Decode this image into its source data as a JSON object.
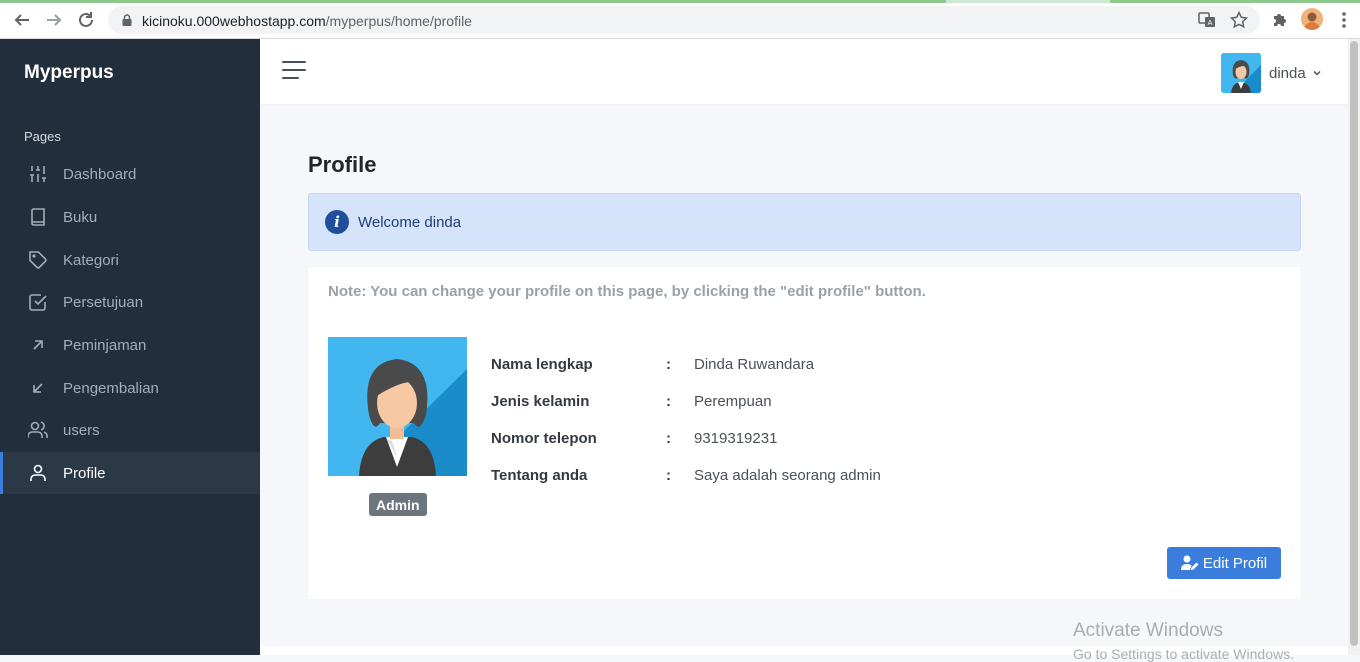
{
  "browser": {
    "url_host": "kicinoku.000webhostapp.com",
    "url_path": "/myperpus/home/profile"
  },
  "sidebar": {
    "brand": "Myperpus",
    "section_label": "Pages",
    "items": [
      {
        "label": "Dashboard",
        "icon": "sliders-icon"
      },
      {
        "label": "Buku",
        "icon": "book-icon"
      },
      {
        "label": "Kategori",
        "icon": "tag-icon"
      },
      {
        "label": "Persetujuan",
        "icon": "check-square-icon"
      },
      {
        "label": "Peminjaman",
        "icon": "arrow-up-right-icon"
      },
      {
        "label": "Pengembalian",
        "icon": "arrow-down-left-icon"
      },
      {
        "label": "users",
        "icon": "users-icon"
      },
      {
        "label": "Profile",
        "icon": "user-icon",
        "active": true
      }
    ]
  },
  "topbar": {
    "username": "dinda"
  },
  "main": {
    "title": "Profile",
    "alert": "Welcome dinda",
    "note": "Note: You can change your profile on this page, by clicking the \"edit profile\" button.",
    "role": "Admin",
    "fields": [
      {
        "label": "Nama lengkap",
        "value": "Dinda Ruwandara"
      },
      {
        "label": "Jenis kelamin",
        "value": "Perempuan"
      },
      {
        "label": "Nomor telepon",
        "value": "9319319231"
      },
      {
        "label": "Tentang anda",
        "value": "Saya adalah seorang admin"
      }
    ],
    "colon": ":",
    "edit_button": "Edit Profil"
  },
  "watermark": {
    "line1": "Activate Windows",
    "line2": "Go to Settings to activate Windows."
  },
  "colors": {
    "sidebar_bg": "#222e3c",
    "accent": "#3b7ddd",
    "alert_bg": "#d6e4fb"
  }
}
